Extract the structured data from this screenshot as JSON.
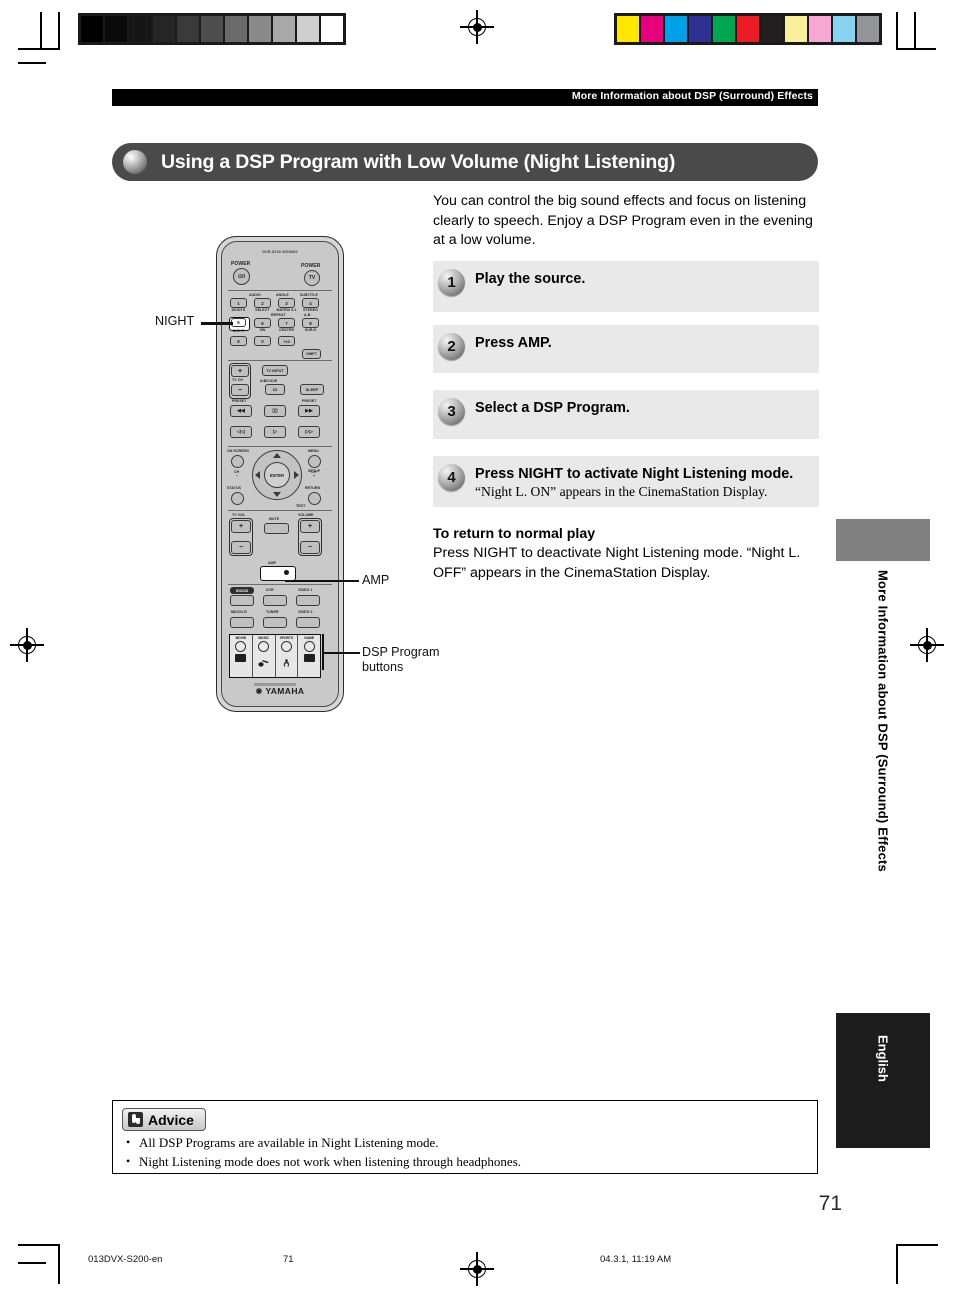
{
  "running_head": "More Information about DSP (Surround) Effects",
  "section_title": "Using a DSP Program with Low Volume (Night Listening)",
  "intro": "You can control the big sound effects and focus on listening clearly to speech. Enjoy a DSP Program even in the evening at a low volume.",
  "steps": [
    {
      "num": "1",
      "heading": "Play the source.",
      "sub": ""
    },
    {
      "num": "2",
      "heading": "Press AMP.",
      "sub": ""
    },
    {
      "num": "3",
      "heading": "Select a DSP Program.",
      "sub": ""
    },
    {
      "num": "4",
      "heading": "Press NIGHT to activate Night Listening mode.",
      "sub": "“Night L. ON” appears in the CinemaStation Display."
    }
  ],
  "return_block": {
    "heading": "To return to normal play",
    "body": "Press NIGHT to deactivate Night Listening mode. “Night L. OFF” appears in the CinemaStation Display."
  },
  "advice": {
    "label": "Advice",
    "items": [
      "All DSP Programs are available in Night Listening mode.",
      "Night Listening mode does not work when listening through headphones."
    ]
  },
  "side_tab": {
    "vertical_text": "More Information about DSP (Surround) Effects",
    "language_tab": "English"
  },
  "page_number": "71",
  "footer": {
    "file": "013DVX-S200-en",
    "page": "71",
    "timestamp": "04.3.1, 11:19 AM"
  },
  "callouts": {
    "night": "NIGHT",
    "amp": "AMP",
    "dsp_buttons": "DSP Program\nbuttons"
  },
  "remote": {
    "model": "DVR-S200 WG5600",
    "power_left": "POWER",
    "power_right": "POWER",
    "power_left_glyph": "⏻/I",
    "power_right_glyph": "TV",
    "top_labels": {
      "audio": "AUDIO",
      "angle": "ANGLE",
      "subtitle": "SUBTITLE",
      "repeat": "REPEAT",
      "ab": "A-B"
    },
    "keys": [
      {
        "n": "1",
        "sub": "DD/DTS"
      },
      {
        "n": "2",
        "sub": "SELECT"
      },
      {
        "n": "3",
        "sub": "MATRIX 6.1"
      },
      {
        "n": "4",
        "sub": "STEREO"
      },
      {
        "n": "5",
        "sub": "NIGHT"
      },
      {
        "n": "6",
        "sub": "SW"
      },
      {
        "n": "7",
        "sub": "CENTER"
      },
      {
        "n": "8",
        "sub": "SUR.H"
      },
      {
        "n": "9",
        "sub": ""
      },
      {
        "n": "0",
        "sub": ""
      },
      {
        "n": "+10",
        "sub": ""
      }
    ],
    "shift": "SHIFT",
    "tv_input": "TV INPUT",
    "tv_ch": "TV CH",
    "abcde": "A/B/C/D/E",
    "sleep": "SLEEP",
    "preset_down": "PRESET",
    "preset_up": "PRESET",
    "on_screen": "ON SCREEN",
    "menu": "MENU",
    "enter": "ENTER",
    "ch_minus": "CH",
    "ch_plus": "CH",
    "status": "STATUS",
    "return": "RETURN",
    "setup": "SETUP",
    "test": "TEST",
    "tv_vol": "TV VOL",
    "mute": "MUTE",
    "volume": "VOLUME",
    "amp": "AMP",
    "sources": [
      "DVD/CD",
      "VCR",
      "VIDEO 1",
      "MD/CD-R",
      "TUNER",
      "VIDEO 2"
    ],
    "dsp_programs": [
      "MOVIE",
      "MUSIC",
      "SPORTS",
      "GAME"
    ],
    "brand": "YAMAHA"
  },
  "calibration": {
    "gray_bars": [
      "#000000",
      "#0a0a0a",
      "#161616",
      "#262626",
      "#3a3a3a",
      "#4e4e4e",
      "#6b6b6b",
      "#8a8a8a",
      "#a9a9a9",
      "#cfcfcf",
      "#ffffff"
    ],
    "color_bars": [
      "#ffe800",
      "#e6007e",
      "#00a0e9",
      "#2e3192",
      "#00a651",
      "#ed1c24",
      "#231f20",
      "#fbf09a",
      "#f9a8d4",
      "#87d3f2",
      "#939598"
    ]
  }
}
